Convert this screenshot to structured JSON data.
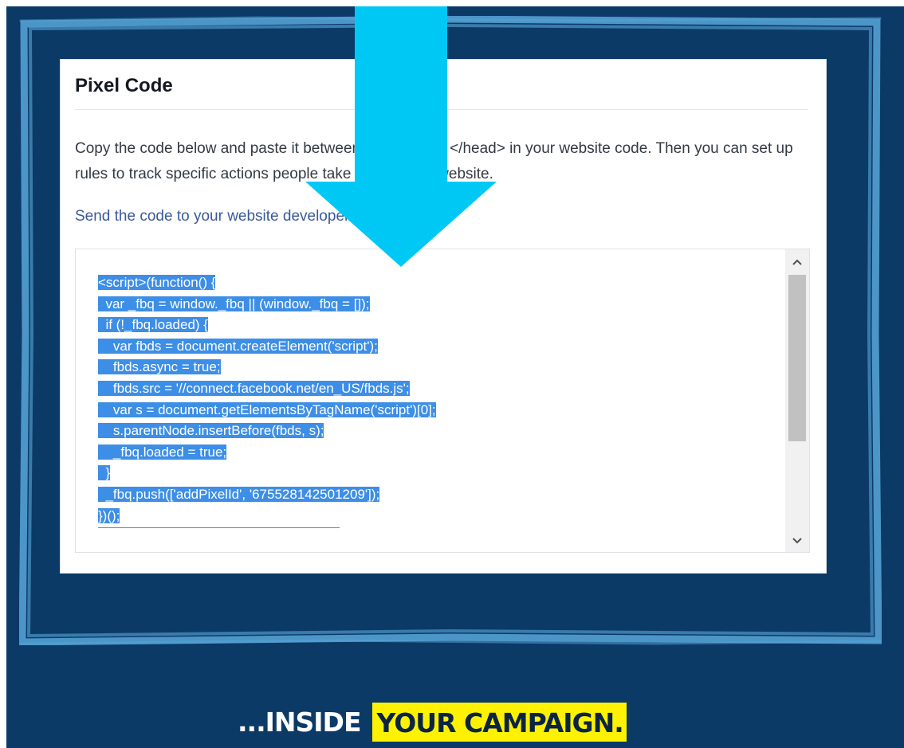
{
  "panel": {
    "title": "Pixel Code",
    "description": "Copy the code below and paste it between <head> and </head> in your website code. Then you can set up rules to track specific actions people take across your website.",
    "send_link": "Send the code to your website developer"
  },
  "code": {
    "lines": [
      "<script>(function() {",
      "  var _fbq = window._fbq || (window._fbq = []);",
      "  if (!_fbq.loaded) {",
      "    var fbds = document.createElement('script');",
      "    fbds.async = true;",
      "    fbds.src = '//connect.facebook.net/en_US/fbds.js';",
      "    var s = document.getElementsByTagName('script')[0];",
      "    s.parentNode.insertBefore(fbds, s);",
      "    _fbq.loaded = true;",
      "  }",
      "  _fbq.push(['addPixelId', '675528142501209']);",
      "})();"
    ],
    "selected": true
  },
  "scrollbar": {
    "up_icon": "chevron-up-icon",
    "down_icon": "chevron-down-icon"
  },
  "caption": {
    "part1": "...INSIDE",
    "part2": "YOUR CAMPAIGN."
  },
  "colors": {
    "background": "#0b3a67",
    "frame": "#58a6d8",
    "arrow": "#00c8f5",
    "selection": "#3d8ee6",
    "highlight": "#fff200",
    "link": "#3b5998"
  }
}
